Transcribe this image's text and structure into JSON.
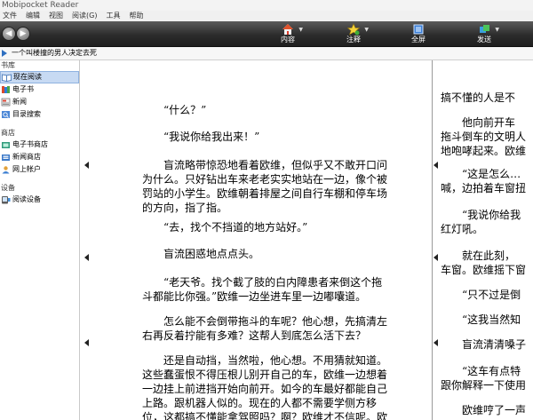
{
  "window": {
    "title": "Mobipocket Reader"
  },
  "menu": [
    "文件",
    "编辑",
    "视图",
    "阅读(G)",
    "工具",
    "帮助"
  ],
  "toolbar": {
    "back": "◀",
    "forward": "▶",
    "buttons": [
      {
        "label": "内容",
        "icon": "home-icon"
      },
      {
        "label": "注释",
        "icon": "star-icon"
      },
      {
        "label": "全屏",
        "icon": "fullscreen-icon"
      },
      {
        "label": "发送",
        "icon": "send-icon"
      }
    ]
  },
  "breadcrumb": {
    "text": "一个叫楼撞的男人决定去死"
  },
  "sidebar": {
    "sections": [
      {
        "title": "书库",
        "items": [
          {
            "label": "现在阅读",
            "selected": true
          },
          {
            "label": "电子书"
          },
          {
            "label": "新闻"
          },
          {
            "label": "目录搜索"
          }
        ]
      },
      {
        "title": "商店",
        "items": [
          {
            "label": "电子书商店"
          },
          {
            "label": "新闻商店"
          },
          {
            "label": "网上帐户"
          }
        ]
      },
      {
        "title": "设备",
        "items": [
          {
            "label": "阅读设备"
          }
        ]
      }
    ]
  },
  "page_left": {
    "paragraphs": [
      "“什么？”",
      "“我说你给我出来！”",
      "盲流略带惊恐地看着欧维，但似乎又不敢开口问为什么。只好钻出车来老老实实地站在一边，像个被罚站的小学生。欧维朝着排屋之间自行车棚和停车场的方向，指了指。",
      "“去，找个不挡道的地方站好。”",
      "盲流困惑地点点头。",
      "“老天爷。找个截了肢的白内障患者来倒这个拖斗都能比你强。”欧维一边坐进车里一边嘟囔道。",
      "怎么能不会倒带拖斗的车呢？他心想，先搞清左右再反着拧能有多难？这帮人到底怎么活下去？",
      "还是自动挡，当然啦，他心想。不用猜就知道。这些蠢蛋恨不得压根儿别开自己的车，欧维一边想着一边挂上前进挡开始向前开。如今的车最好都能自己上路。跟机器人似的。现在的人都不需要学侧方移位，这都搞不懂能拿驾照吗？啊？欧维才不信呢。欧维甚至高度怀疑连这都"
    ]
  },
  "page_right": {
    "lines": [
      "搞不懂的人是不",
      "　　他向前开车",
      "拖斗倒车的文明人",
      "地咆哮起来。欧维",
      "",
      "　　“这是怎么…",
      "喊，边拍着车窗扭",
      "",
      "　　“我说你给我",
      "红灯吼。",
      "",
      "　　就在此刻，",
      "车窗。欧维摇下窗",
      "",
      "　　“只不过是倒",
      "",
      "　　“这我当然知",
      "",
      "　　盲流清清嗓子",
      "",
      "　　“这车有点特",
      "跟你解释一下使用",
      "",
      "　　欧维哼了一声"
    ]
  },
  "colors": {
    "toolbar": "#2c2c2c",
    "selection": "#c7daf3",
    "accent": "#2e6fc0"
  }
}
